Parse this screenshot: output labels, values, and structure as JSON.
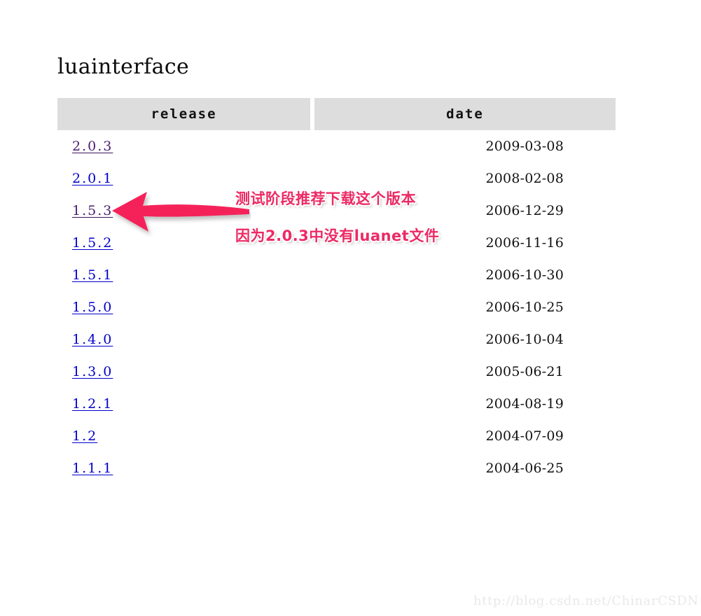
{
  "page": {
    "title": "luainterface",
    "background_color": "#ffffff"
  },
  "table": {
    "columns": [
      {
        "key": "release",
        "label": "release"
      },
      {
        "key": "date",
        "label": "date"
      }
    ],
    "header_background": "#dddddd",
    "rows": [
      {
        "release": "2.0.3",
        "date": "2009-03-08",
        "link_state": "visited"
      },
      {
        "release": "2.0.1",
        "date": "2008-02-08",
        "link_state": "unvisited"
      },
      {
        "release": "1.5.3",
        "date": "2006-12-29",
        "link_state": "visited"
      },
      {
        "release": "1.5.2",
        "date": "2006-11-16",
        "link_state": "unvisited"
      },
      {
        "release": "1.5.1",
        "date": "2006-10-30",
        "link_state": "unvisited"
      },
      {
        "release": "1.5.0",
        "date": "2006-10-25",
        "link_state": "unvisited"
      },
      {
        "release": "1.4.0",
        "date": "2006-10-04",
        "link_state": "unvisited"
      },
      {
        "release": "1.3.0",
        "date": "2005-06-21",
        "link_state": "unvisited"
      },
      {
        "release": "1.2.1",
        "date": "2004-08-19",
        "link_state": "unvisited"
      },
      {
        "release": "1.2",
        "date": "2004-07-09",
        "link_state": "unvisited"
      },
      {
        "release": "1.1.1",
        "date": "2004-06-25",
        "link_state": "unvisited"
      }
    ]
  },
  "annotation": {
    "arrow_icon": "left-arrow-icon",
    "arrow_color": "#f5225a",
    "text_color": "#ec2a64",
    "line_1": "测试阶段推荐下载这个版本",
    "line_2": "因为2.0.3中没有luanet文件"
  },
  "watermark": {
    "text": "http://blog.csdn.net/ChinarCSDN",
    "color": "#e9e9e9"
  },
  "link_colors": {
    "unvisited": "#0000cc",
    "visited": "#4b1b6e"
  }
}
